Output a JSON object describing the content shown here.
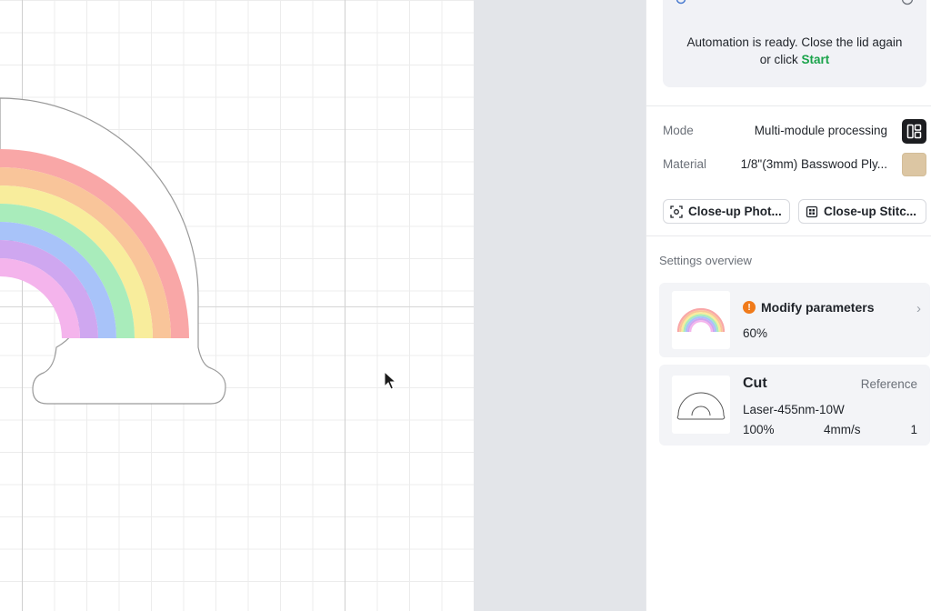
{
  "automation": {
    "message_line1": "Automation is ready. Close the lid again",
    "message_prefix": "or click",
    "start_link": "Start"
  },
  "settings": {
    "mode_label": "Mode",
    "mode_value": "Multi-module processing",
    "mode_icon": "layout-panels-icon",
    "material_label": "Material",
    "material_value": "1/8\"(3mm) Basswood Ply...",
    "material_swatch_color": "#dcc6a3"
  },
  "actions": {
    "closeup_photo": "Close-up Phot...",
    "closeup_stitch": "Close-up Stitc..."
  },
  "overview": {
    "title": "Settings overview",
    "modify": {
      "title": "Modify parameters",
      "percent": "60%"
    },
    "cut": {
      "title": "Cut",
      "reference": "Reference",
      "laser": "Laser-455nm-10W",
      "power": "100%",
      "speed": "4mm/s",
      "passes": "1"
    }
  },
  "colors": {
    "accent_green": "#1aa34a",
    "warning_orange": "#f07a1a",
    "rainbow": [
      "#f9a7a7",
      "#f9c59a",
      "#f8ed9c",
      "#a9ecbb",
      "#a8c3f9",
      "#cfa7f0",
      "#f4b4ec"
    ]
  }
}
